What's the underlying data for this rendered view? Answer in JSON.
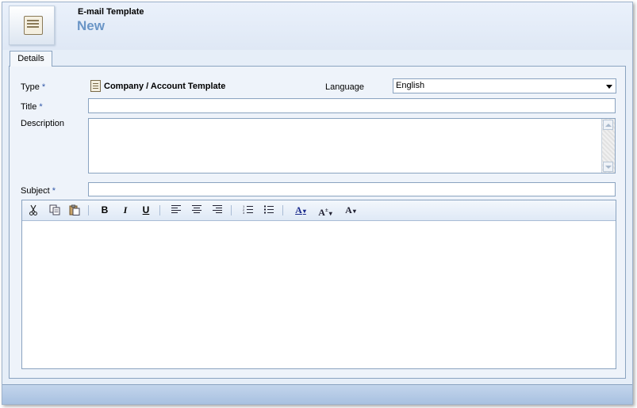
{
  "header": {
    "entity_name": "E-mail Template",
    "record_title": "New",
    "icon": "email-template-icon"
  },
  "tabs": [
    {
      "label": "Details",
      "active": true
    }
  ],
  "form": {
    "type": {
      "label": "Type",
      "required_mark": "*",
      "value": "Company / Account Template",
      "icon": "document-icon"
    },
    "language": {
      "label": "Language",
      "value": "English"
    },
    "title": {
      "label": "Title",
      "required_mark": "*",
      "value": ""
    },
    "description": {
      "label": "Description",
      "value": ""
    },
    "subject": {
      "label": "Subject",
      "required_mark": "*",
      "value": ""
    }
  },
  "editor_toolbar": [
    {
      "name": "cut",
      "icon": "scissors-icon"
    },
    {
      "name": "copy",
      "icon": "copy-icon"
    },
    {
      "name": "paste",
      "icon": "paste-icon"
    },
    {
      "name": "bold",
      "glyph": "B"
    },
    {
      "name": "italic",
      "glyph": "I"
    },
    {
      "name": "underline",
      "glyph": "U"
    },
    {
      "name": "align-left",
      "icon": "align-left-icon"
    },
    {
      "name": "align-center",
      "icon": "align-center-icon"
    },
    {
      "name": "align-right",
      "icon": "align-right-icon"
    },
    {
      "name": "numbered-list",
      "icon": "numbered-list-icon"
    },
    {
      "name": "bulleted-list",
      "icon": "bulleted-list-icon"
    },
    {
      "name": "highlight-color",
      "glyph": "A"
    },
    {
      "name": "font-size",
      "glyph": "A"
    },
    {
      "name": "font-color",
      "glyph": "A"
    }
  ],
  "editor_body": {
    "value": ""
  },
  "colors": {
    "accent": "#6a95c6",
    "border": "#8aa3c0",
    "panel": "#eef3fa",
    "required": "#2f56a8"
  }
}
